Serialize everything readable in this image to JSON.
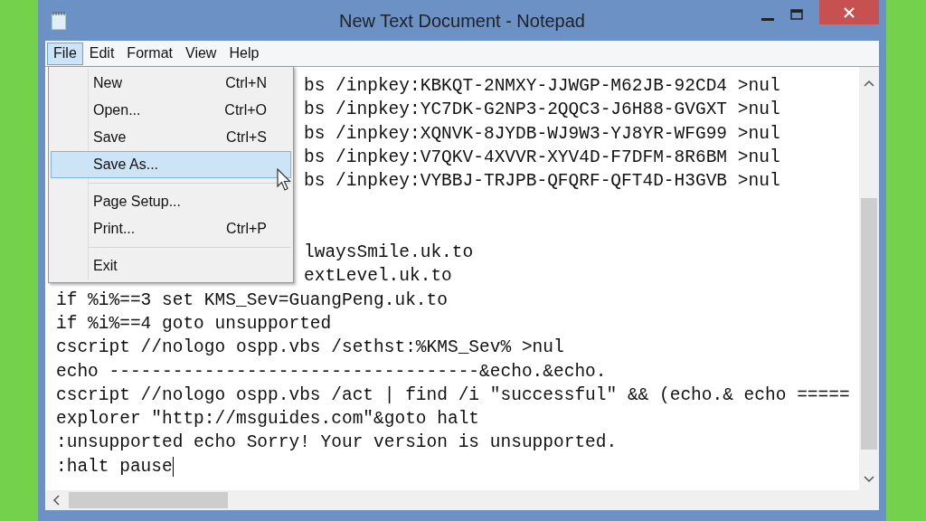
{
  "window": {
    "title": "New Text Document - Notepad"
  },
  "menubar": [
    {
      "label": "File",
      "selected": true
    },
    {
      "label": "Edit",
      "selected": false
    },
    {
      "label": "Format",
      "selected": false
    },
    {
      "label": "View",
      "selected": false
    },
    {
      "label": "Help",
      "selected": false
    }
  ],
  "file_menu": [
    {
      "kind": "item",
      "label": "New",
      "shortcut": "Ctrl+N",
      "selected": false
    },
    {
      "kind": "item",
      "label": "Open...",
      "shortcut": "Ctrl+O",
      "selected": false
    },
    {
      "kind": "item",
      "label": "Save",
      "shortcut": "Ctrl+S",
      "selected": false
    },
    {
      "kind": "item",
      "label": "Save As...",
      "selected": true
    },
    {
      "kind": "separator"
    },
    {
      "kind": "item",
      "label": "Page Setup...",
      "selected": false
    },
    {
      "kind": "item",
      "label": "Print...",
      "shortcut": "Ctrl+P",
      "selected": false
    },
    {
      "kind": "separator"
    },
    {
      "kind": "item",
      "label": "Exit",
      "selected": false
    }
  ],
  "editor_lines": [
    {
      "kind": "partial",
      "text": "bs /inpkey:KBKQT-2NMXY-JJWGP-M62JB-92CD4 >nul"
    },
    {
      "kind": "partial",
      "text": "bs /inpkey:YC7DK-G2NP3-2QQC3-J6H88-GVGXT >nul"
    },
    {
      "kind": "partial",
      "text": "bs /inpkey:XQNVK-8JYDB-WJ9W3-YJ8YR-WFG99 >nul"
    },
    {
      "kind": "partial",
      "text": "bs /inpkey:V7QKV-4XVVR-XYV4D-F7DFM-8R6BM >nul"
    },
    {
      "kind": "partial",
      "text": "bs /inpkey:VYBBJ-TRJPB-QFQRF-QFT4D-H3GVB >nul"
    },
    {
      "kind": "hidden"
    },
    {
      "kind": "hidden"
    },
    {
      "kind": "partial",
      "text": "lwaysSmile.uk.to"
    },
    {
      "kind": "partial",
      "text": "extLevel.uk.to"
    },
    {
      "kind": "full",
      "text": "if %i%==3 set KMS_Sev=GuangPeng.uk.to"
    },
    {
      "kind": "full",
      "text": "if %i%==4 goto unsupported"
    },
    {
      "kind": "full",
      "text": "cscript //nologo ospp.vbs /sethst:%KMS_Sev% >nul"
    },
    {
      "kind": "full",
      "text": "echo -----------------------------------&echo.&echo."
    },
    {
      "kind": "full",
      "text": "cscript //nologo ospp.vbs /act | find /i \"successful\" && (echo.& echo ====="
    },
    {
      "kind": "full",
      "text": "explorer \"http://msguides.com\"&goto halt"
    },
    {
      "kind": "full",
      "text": ":unsupported echo Sorry! Your version is unsupported."
    },
    {
      "kind": "full",
      "text": ":halt pause"
    }
  ]
}
